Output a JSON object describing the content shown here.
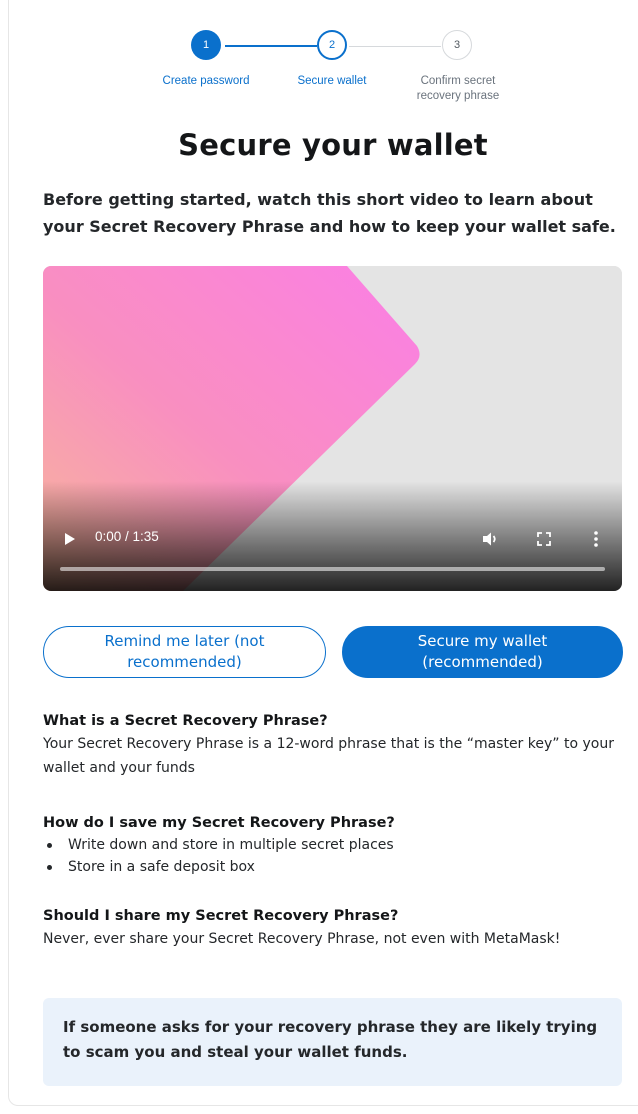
{
  "stepper": {
    "steps": [
      {
        "number": "1",
        "label": "Create password"
      },
      {
        "number": "2",
        "label": "Secure wallet"
      },
      {
        "number": "3",
        "label": "Confirm secret recovery phrase"
      }
    ],
    "current_step": 2
  },
  "title": "Secure your wallet",
  "intro": "Before getting started, watch this short video to learn about your Secret Recovery Phrase and how to keep your wallet safe.",
  "video": {
    "time": "0:00 / 1:35",
    "progress_fraction": 0,
    "icons": {
      "play": "play-icon",
      "volume": "volume-icon",
      "fullscreen": "fullscreen-icon",
      "more": "more-vertical-icon"
    }
  },
  "buttons": {
    "remind_later": "Remind me later (not recommended)",
    "secure_wallet": "Secure my wallet (recommended)"
  },
  "faq": [
    {
      "question": "What is a Secret Recovery Phrase?",
      "answer": "Your Secret Recovery Phrase is a 12-word phrase that is the “master key” to your wallet and your funds"
    },
    {
      "question": "How do I save my Secret Recovery Phrase?",
      "bullets": [
        "Write down and store in multiple secret places",
        "Store in a safe deposit box"
      ]
    },
    {
      "question": "Should I share my Secret Recovery Phrase?",
      "answer": "Never, ever share your Secret Recovery Phrase, not even with MetaMask!"
    }
  ],
  "warning": "If someone asks for your recovery phrase they are likely trying to scam you and steal your wallet funds.",
  "colors": {
    "accent": "#0a70cc",
    "warning_bg": "#eaf2fb",
    "inactive": "#d6d9dc"
  }
}
